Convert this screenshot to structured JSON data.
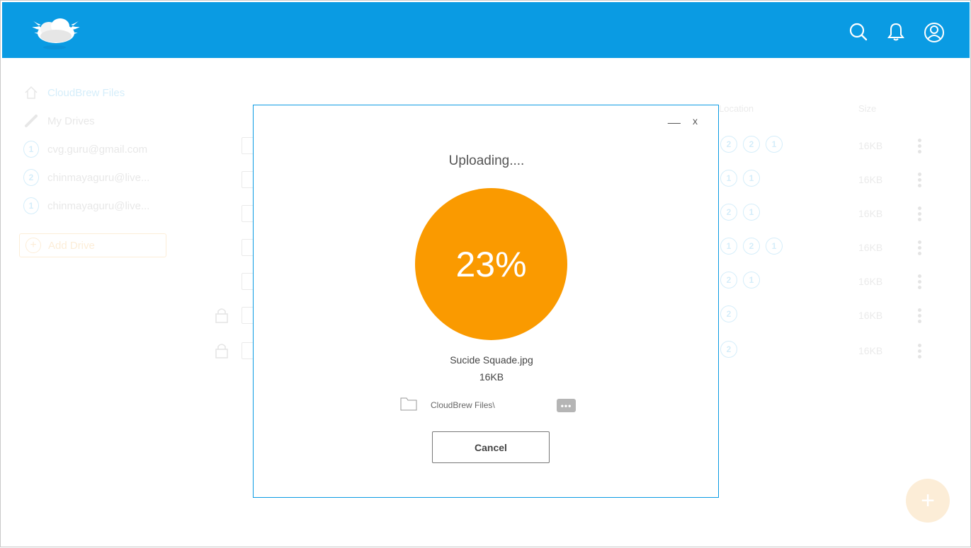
{
  "app": {
    "name": "CloudBrew",
    "accent_color": "#0a9be3",
    "orange_color": "#fa9a00"
  },
  "topbar": {
    "icons": [
      "search-icon",
      "bell-icon",
      "user-icon"
    ]
  },
  "sidebar": {
    "items": [
      {
        "label": "CloudBrew Files",
        "icon": "home-icon"
      },
      {
        "label": "My Drives",
        "icon": "link-icon"
      },
      {
        "label": "cvg.guru@gmail.com",
        "icon": "drive-1-icon"
      },
      {
        "label": "chinmayaguru@live...",
        "icon": "drive-2-icon"
      },
      {
        "label": "chinmayaguru@live...",
        "icon": "drive-1-dropbox-icon"
      }
    ],
    "add_drive_label": "Add Drive"
  },
  "table": {
    "headers": {
      "location": "Location",
      "size": "Size"
    },
    "rows": [
      {
        "size": "16KB",
        "locked": false,
        "locations": [
          "2",
          "2",
          "1"
        ]
      },
      {
        "size": "16KB",
        "locked": false,
        "locations": [
          "1",
          "1"
        ]
      },
      {
        "size": "16KB",
        "locked": false,
        "locations": [
          "2",
          "1"
        ]
      },
      {
        "size": "16KB",
        "locked": false,
        "locations": [
          "1",
          "2",
          "1"
        ]
      },
      {
        "size": "16KB",
        "locked": false,
        "locations": [
          "2",
          "1"
        ]
      },
      {
        "size": "16KB",
        "locked": true,
        "locations": [
          "2"
        ]
      },
      {
        "size": "16KB",
        "locked": true,
        "locations": [
          "2"
        ]
      }
    ]
  },
  "fab_label": "+",
  "modal": {
    "minimize_label": "__",
    "close_label": "x",
    "title": "Uploading....",
    "percent_text": "23%",
    "progress": 0.23,
    "file_name": "Sucide Squade.jpg",
    "file_size": "16KB",
    "path": "CloudBrew Files\\",
    "browse_label": "•••",
    "cancel_label": "Cancel"
  }
}
